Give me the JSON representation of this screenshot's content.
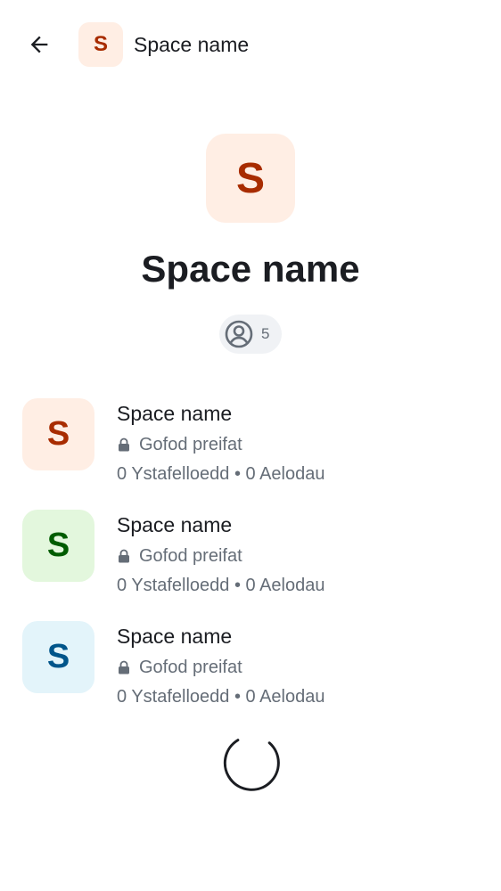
{
  "header": {
    "title": "Space name",
    "avatar_letter": "S",
    "avatar_bg": "#ffeee4",
    "avatar_fg": "#a82c00",
    "back_icon": "arrow-left-icon"
  },
  "hero": {
    "avatar_letter": "S",
    "avatar_bg": "#ffeee4",
    "avatar_fg": "#a82c00",
    "title": "Space name",
    "member_count": "5",
    "member_icon": "user-circle-icon"
  },
  "spaces": [
    {
      "letter": "S",
      "bg": "#ffeee4",
      "fg": "#a82c00",
      "name": "Space name",
      "privacy": "Gofod preifat",
      "stats": "0 Ystafelloedd • 0 Aelodau"
    },
    {
      "letter": "S",
      "bg": "#e3f7dd",
      "fg": "#005c00",
      "name": "Space name",
      "privacy": "Gofod preifat",
      "stats": "0 Ystafelloedd • 0 Aelodau"
    },
    {
      "letter": "S",
      "bg": "#e3f4fa",
      "fg": "#00558a",
      "name": "Space name",
      "privacy": "Gofod preifat",
      "stats": "0 Ystafelloedd • 0 Aelodau"
    }
  ],
  "colors": {
    "text_primary": "#1b1d22",
    "text_secondary": "#656d77",
    "pill_bg": "#f0f2f5"
  },
  "loading": {
    "icon": "loading-spinner-icon"
  }
}
